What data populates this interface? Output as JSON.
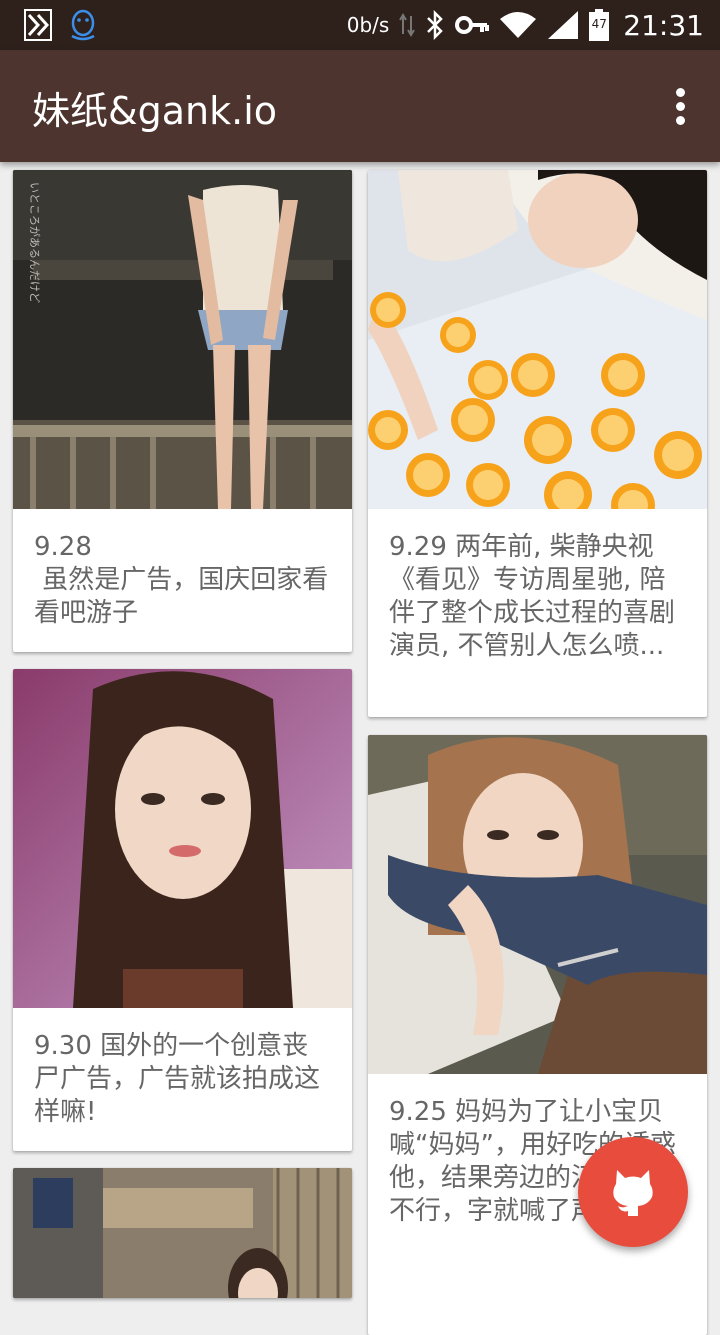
{
  "status_bar": {
    "net_speed": "0b/s",
    "battery_level": "47",
    "time": "21:31",
    "icons": [
      "app-notification-icon",
      "qq-icon",
      "data-arrows-icon",
      "bluetooth-icon",
      "vpn-key-icon",
      "wifi-icon",
      "signal-icon",
      "battery-icon"
    ]
  },
  "toolbar": {
    "title": "妹纸&gank.io",
    "overflow_icon": "more-vert-icon"
  },
  "feed": {
    "left": [
      {
        "caption": "9.28\n 虽然是广告，国庆回家看看吧游子"
      },
      {
        "caption": "9.30 国外的一个创意丧尸广告，广告就该拍成这样嘛!"
      },
      {
        "caption": ""
      }
    ],
    "right": [
      {
        "caption": "9.29 两年前, 柴静央视《看见》专访周星驰, 陪伴了整个成长过程的喜剧演员, 不管别人怎么喷..."
      },
      {
        "caption": "9.25 妈妈为了让小宝贝喊“妈妈”，用好吃的诱惑他，结果旁边的汪汪急得不行，字就喊了声..."
      }
    ]
  },
  "fab": {
    "icon": "github-octocat-icon",
    "color": "#e74c3c"
  },
  "colors": {
    "toolbar": "#4e342e",
    "status_bar": "#2e211c",
    "background": "#eeeeee"
  }
}
